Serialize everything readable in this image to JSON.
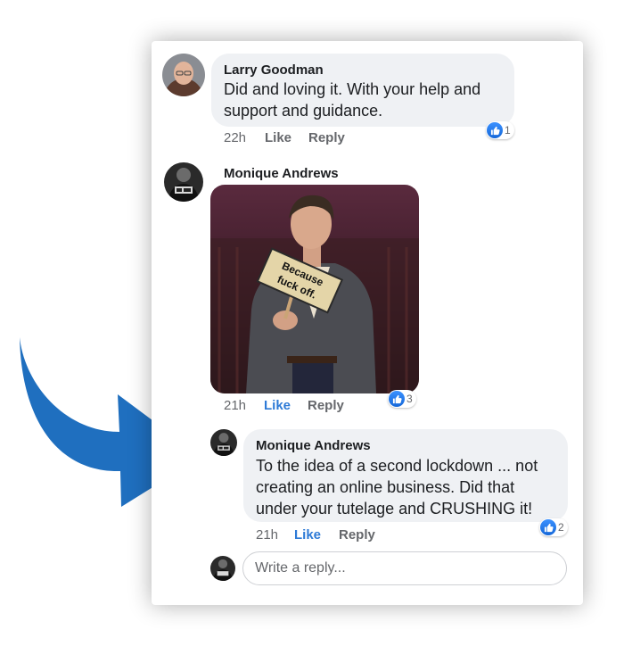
{
  "comments": [
    {
      "author": "Larry Goodman",
      "text_lines": [
        "Did and loving it.  With your help and",
        "support and guidance."
      ],
      "time": "22h",
      "like_label": "Like",
      "reply_label": "Reply",
      "reactions": "1",
      "liked": false
    },
    {
      "author": "Monique Andrews",
      "image_sign_lines": [
        "Because",
        "fuck off."
      ],
      "time": "21h",
      "like_label": "Like",
      "reply_label": "Reply",
      "reactions": "3",
      "liked": true
    },
    {
      "author": "Monique Andrews",
      "text_lines": [
        "To the idea of a second lockdown ... not",
        "creating an online business. Did that",
        "under your tutelage and CRUSHING it!"
      ],
      "time": "21h",
      "like_label": "Like",
      "reply_label": "Reply",
      "reactions": "2",
      "liked": true
    }
  ],
  "reply_input": {
    "placeholder": "Write a reply..."
  },
  "colors": {
    "accent_blue": "#2d7ad6",
    "arrow_blue": "#1f6fbf",
    "bubble_bg": "#eff1f4"
  },
  "icons": {
    "reaction": "like-thumbs-up-icon",
    "annotation": "curved-arrow-icon"
  }
}
